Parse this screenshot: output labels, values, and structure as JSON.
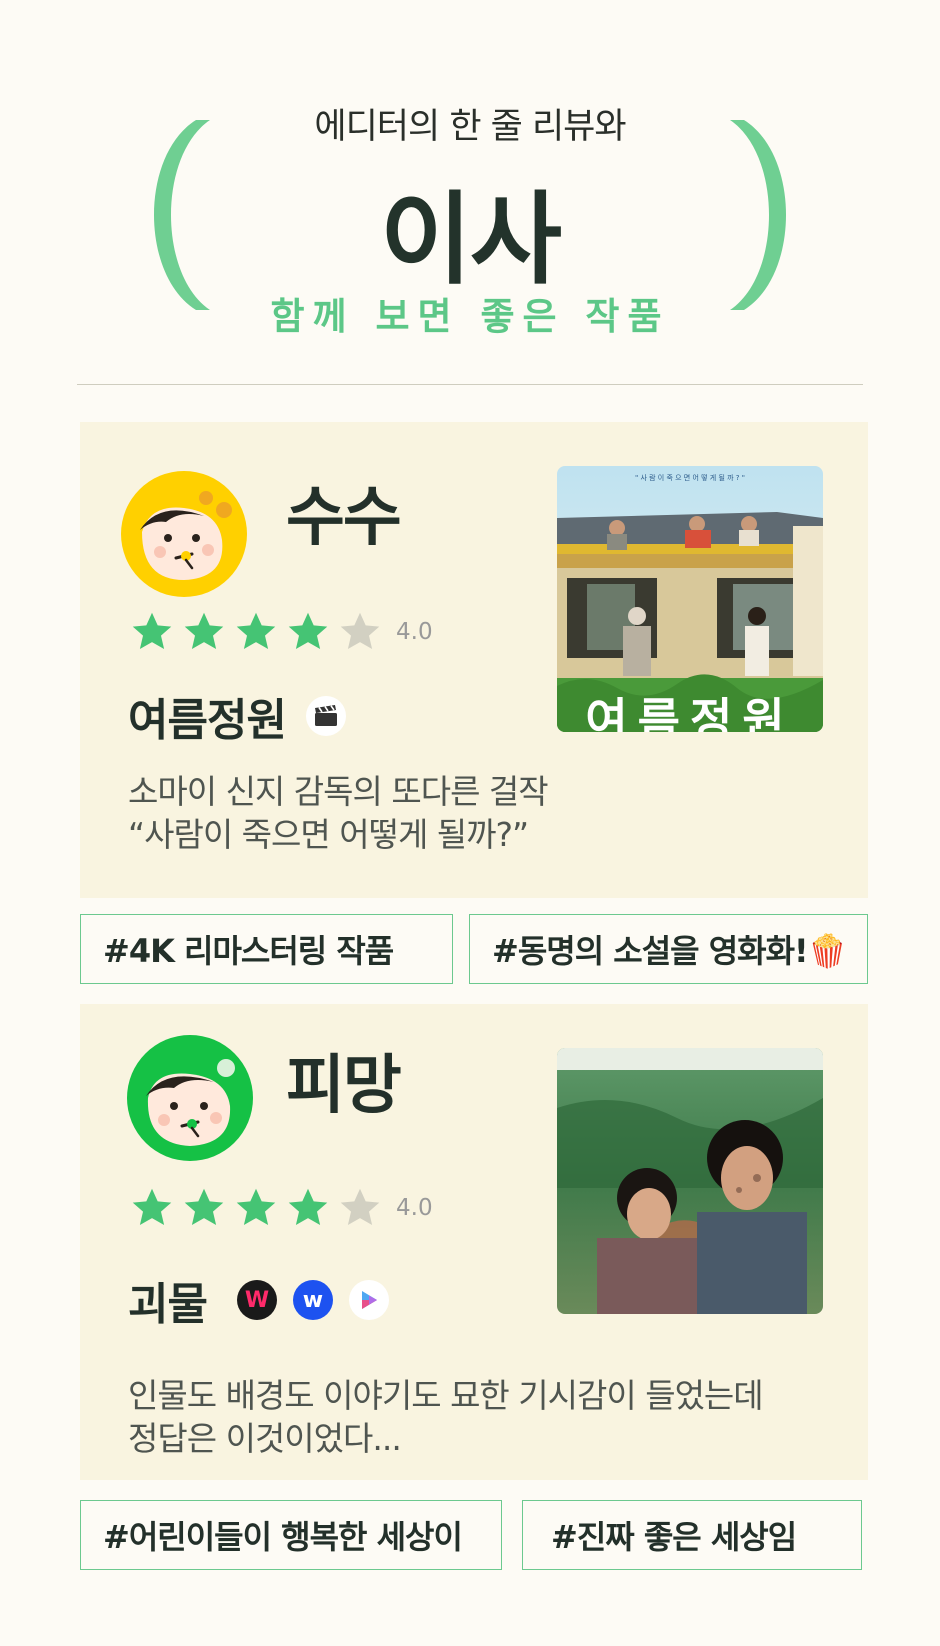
{
  "header": {
    "subtitle_top": "에디터의 한 줄 리뷰와",
    "title": "이사",
    "subtitle_bottom": "함께 보면 좋은 작품",
    "accent_color": "#6fcf92"
  },
  "cards": [
    {
      "reviewer": "수수",
      "avatar_color": "#ffd000",
      "rating": 4,
      "rating_label": "4.0",
      "movie_title": "여름정원",
      "platform_icons": [
        "clapperboard-icon"
      ],
      "poster_caption": "\" 사 람 이   죽 으 면   어 떻 게   될 까 ? \"",
      "poster_title": "여름정원",
      "review_lines": [
        "소마이 신지 감독의 또다른 걸작",
        "“사람이 죽으면 어떻게 될까?”"
      ],
      "tags": [
        "#4K 리마스터링 작품",
        "#동명의 소설을 영화화!🍿"
      ]
    },
    {
      "reviewer": "피망",
      "avatar_color": "#15c145",
      "rating": 4,
      "rating_label": "4.0",
      "movie_title": "괴물",
      "platform_icons": [
        "wavve-icon",
        "watcha-icon",
        "google-play-icon"
      ],
      "review_lines": [
        "인물도 배경도 이야기도 묘한 기시감이 들었는데",
        "정답은 이것이었다..."
      ],
      "tags": [
        "#어린이들이 행복한 세상이",
        "#진짜 좋은 세상임"
      ]
    }
  ],
  "colors": {
    "background": "#fdfbf5",
    "card": "#f9f4e0",
    "star_filled": "#45c474",
    "star_empty": "#d2d0c2",
    "tag_border": "#6cc98f"
  }
}
